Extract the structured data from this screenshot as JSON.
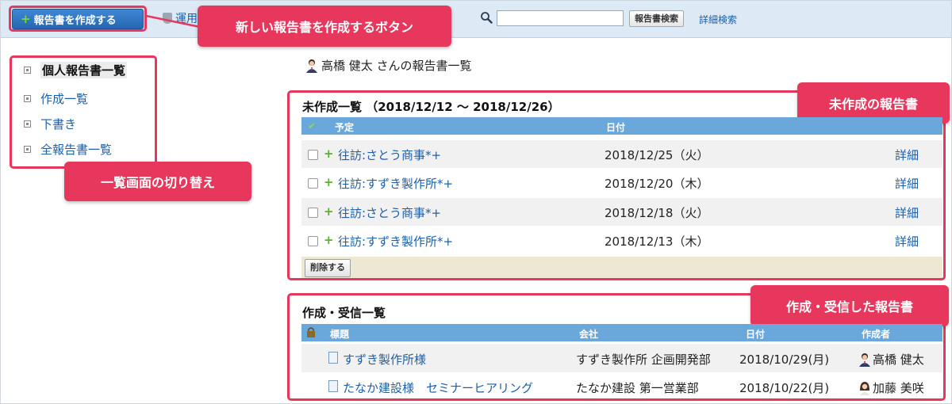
{
  "toolbar": {
    "create_label": "報告書を作成する",
    "link_label": "運用",
    "search_value": "",
    "search_button": "報告書検索",
    "advanced_search": "詳細検索"
  },
  "callouts": {
    "create": "新しい報告書を作成するボタン",
    "switch": "一覧画面の切り替え",
    "uncreated": "未作成の報告書",
    "received": "作成・受信した報告書"
  },
  "sidebar": {
    "items": [
      {
        "label": "個人報告書一覧",
        "active": true
      },
      {
        "label": "作成一覧",
        "active": false
      },
      {
        "label": "下書き",
        "active": false
      },
      {
        "label": "全報告書一覧",
        "active": false
      }
    ]
  },
  "page": {
    "heading": "高橋 健太 さんの報告書一覧"
  },
  "uncreated": {
    "title": "未作成一覧 （2018/12/12 〜 2018/12/26）",
    "col_plan": "予定",
    "col_date": "日付",
    "rows": [
      {
        "name": "往訪:さとう商事*+",
        "date": "2018/12/25（火）",
        "detail": "詳細"
      },
      {
        "name": "往訪:すずき製作所*+",
        "date": "2018/12/20（木）",
        "detail": "詳細"
      },
      {
        "name": "往訪:さとう商事*+",
        "date": "2018/12/18（火）",
        "detail": "詳細"
      },
      {
        "name": "往訪:すずき製作所*+",
        "date": "2018/12/13（木）",
        "detail": "詳細"
      }
    ],
    "delete_label": "削除する"
  },
  "received": {
    "title": "作成・受信一覧",
    "col_title": "標題",
    "col_company": "会社",
    "col_date": "日付",
    "col_author": "作成者",
    "rows": [
      {
        "title": "すずき製作所様",
        "company": "すずき製作所 企画開発部",
        "date": "2018/10/29(月)",
        "author": "高橋 健太"
      },
      {
        "title": "たなか建設様　セミナーヒアリング",
        "company": "たなか建設 第一営業部",
        "date": "2018/10/22(月)",
        "author": "加藤 美咲"
      }
    ]
  },
  "colors": {
    "accent": "#e8375c",
    "header_blue": "#6aa8dc",
    "link": "#1d5fa8",
    "toolbar_bg": "#dde9f5"
  }
}
